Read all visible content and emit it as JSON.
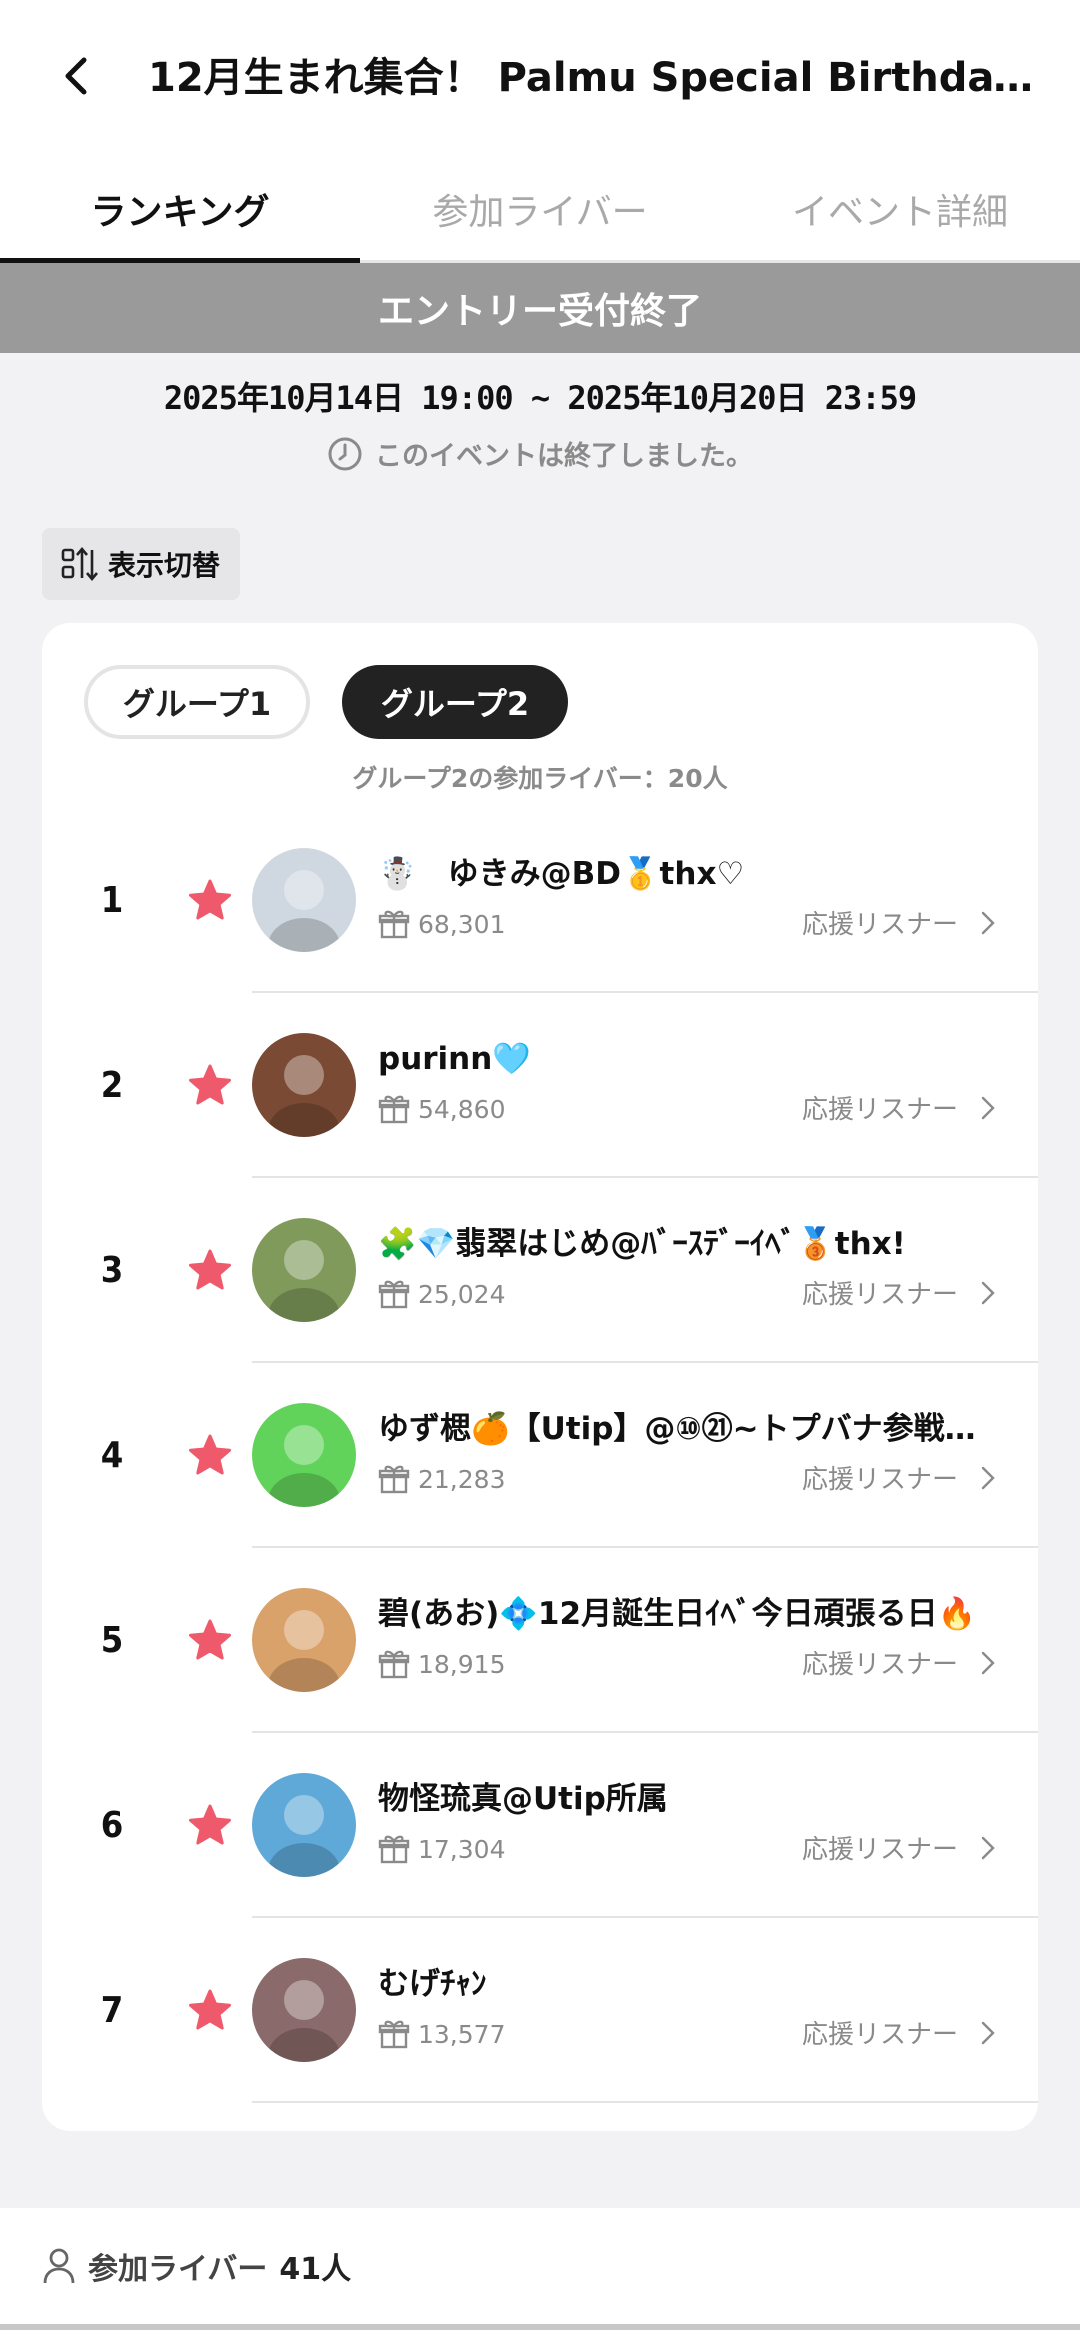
{
  "header": {
    "title": "12月生まれ集合！ Palmu Special Birthday(…"
  },
  "tabs": [
    {
      "label": "ランキング",
      "active": true
    },
    {
      "label": "参加ライバー",
      "active": false
    },
    {
      "label": "イベント詳細",
      "active": false
    }
  ],
  "banner": "エントリー受付終了",
  "period": "2025年10月14日 19:00 ~ 2025年10月20日 23:59",
  "ended_text": "このイベントは終了しました。",
  "toggle_label": "表示切替",
  "groups": {
    "group1": "グループ1",
    "group2": "グループ2",
    "count_text": "グループ2の参加ライバー：20人"
  },
  "ranking": [
    {
      "rank": "1",
      "name": "☃️　ゆきみ@BD🥇thx♡",
      "score": "68,301",
      "link": "応援リスナー",
      "avatar_color": "#cfd8e0"
    },
    {
      "rank": "2",
      "name": "purinn🩵",
      "score": "54,860",
      "link": "応援リスナー",
      "avatar_color": "#7a4a34"
    },
    {
      "rank": "3",
      "name": "🧩💎翡翠はじめ@ﾊﾞｰｽﾃﾞｰｲﾍﾞ🥉thx!",
      "score": "25,024",
      "link": "応援リスナー",
      "avatar_color": "#7f9a5b"
    },
    {
      "rank": "4",
      "name": "ゆず楒🍊【Utip】@⑩㉑~トプバナ参戦🔥…",
      "score": "21,283",
      "link": "応援リスナー",
      "avatar_color": "#62d35a"
    },
    {
      "rank": "5",
      "name": "碧(あお)💠12月誕生日ｲﾍﾞ今日頑張る日🔥",
      "score": "18,915",
      "link": "応援リスナー",
      "avatar_color": "#d9a26b"
    },
    {
      "rank": "6",
      "name": "物怪琉真@Utip所属",
      "score": "17,304",
      "link": "応援リスナー",
      "avatar_color": "#5fa9d8"
    },
    {
      "rank": "7",
      "name": "むげﾁｬﾝ",
      "score": "13,577",
      "link": "応援リスナー",
      "avatar_color": "#8a6a6a"
    }
  ],
  "bottom": {
    "label": "参加ライバー",
    "count": "41人"
  },
  "colors": {
    "star": "#ee5a6b",
    "banner": "#9a9a9a",
    "active_group": "#222222"
  }
}
